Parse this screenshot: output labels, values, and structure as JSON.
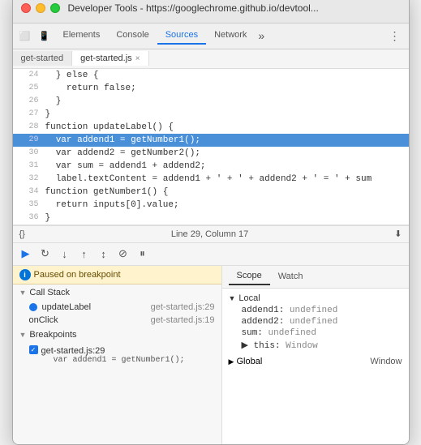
{
  "window": {
    "title": "Developer Tools - https://googlechrome.github.io/devtool..."
  },
  "tabs": [
    {
      "label": "Elements",
      "active": false
    },
    {
      "label": "Console",
      "active": false
    },
    {
      "label": "Sources",
      "active": true
    },
    {
      "label": "Network",
      "active": false
    }
  ],
  "file_tabs": [
    {
      "label": "get-started",
      "active": false,
      "closeable": false
    },
    {
      "label": "get-started.js",
      "active": true,
      "closeable": true
    }
  ],
  "code_lines": [
    {
      "num": "24",
      "content": "  } else {",
      "highlighted": false
    },
    {
      "num": "25",
      "content": "    return false;",
      "highlighted": false
    },
    {
      "num": "26",
      "content": "  }",
      "highlighted": false
    },
    {
      "num": "27",
      "content": "}",
      "highlighted": false
    },
    {
      "num": "28",
      "content": "function updateLabel() {",
      "highlighted": false
    },
    {
      "num": "29",
      "content": "  var addend1 = getNumber1();",
      "highlighted": true
    },
    {
      "num": "30",
      "content": "  var addend2 = getNumber2();",
      "highlighted": false
    },
    {
      "num": "31",
      "content": "  var sum = addend1 + addend2;",
      "highlighted": false
    },
    {
      "num": "32",
      "content": "  label.textContent = addend1 + ' + ' + addend2 + ' = ' + sum",
      "highlighted": false
    },
    {
      "num": "34",
      "content": "function getNumber1() {",
      "highlighted": false
    },
    {
      "num": "35",
      "content": "  return inputs[0].value;",
      "highlighted": false
    },
    {
      "num": "36",
      "content": "}",
      "highlighted": false
    }
  ],
  "status_bar": {
    "position": "Line 29, Column 17"
  },
  "debug_toolbar": {
    "buttons": [
      "▶",
      "⟳",
      "↓",
      "↑",
      "↕",
      "⏸"
    ]
  },
  "breakpoint_notice": "Paused on breakpoint",
  "call_stack": {
    "header": "Call Stack",
    "items": [
      {
        "name": "updateLabel",
        "location": "get-started.js:29",
        "active": true
      },
      {
        "name": "onClick",
        "location": "get-started.js:19",
        "active": false
      }
    ]
  },
  "breakpoints": {
    "header": "Breakpoints",
    "items": [
      {
        "location": "get-started.js:29",
        "code": "var addend1 = getNumber1();"
      }
    ]
  },
  "scope": {
    "tabs": [
      "Scope",
      "Watch"
    ],
    "active_tab": "Scope",
    "local": {
      "header": "Local",
      "items": [
        {
          "name": "addend1:",
          "value": "undefined"
        },
        {
          "name": "addend2:",
          "value": "undefined"
        },
        {
          "name": "sum:",
          "value": "undefined"
        }
      ],
      "this": {
        "name": "▶ this:",
        "value": "Window"
      }
    },
    "global": {
      "header": "Global",
      "value": "Window"
    }
  }
}
